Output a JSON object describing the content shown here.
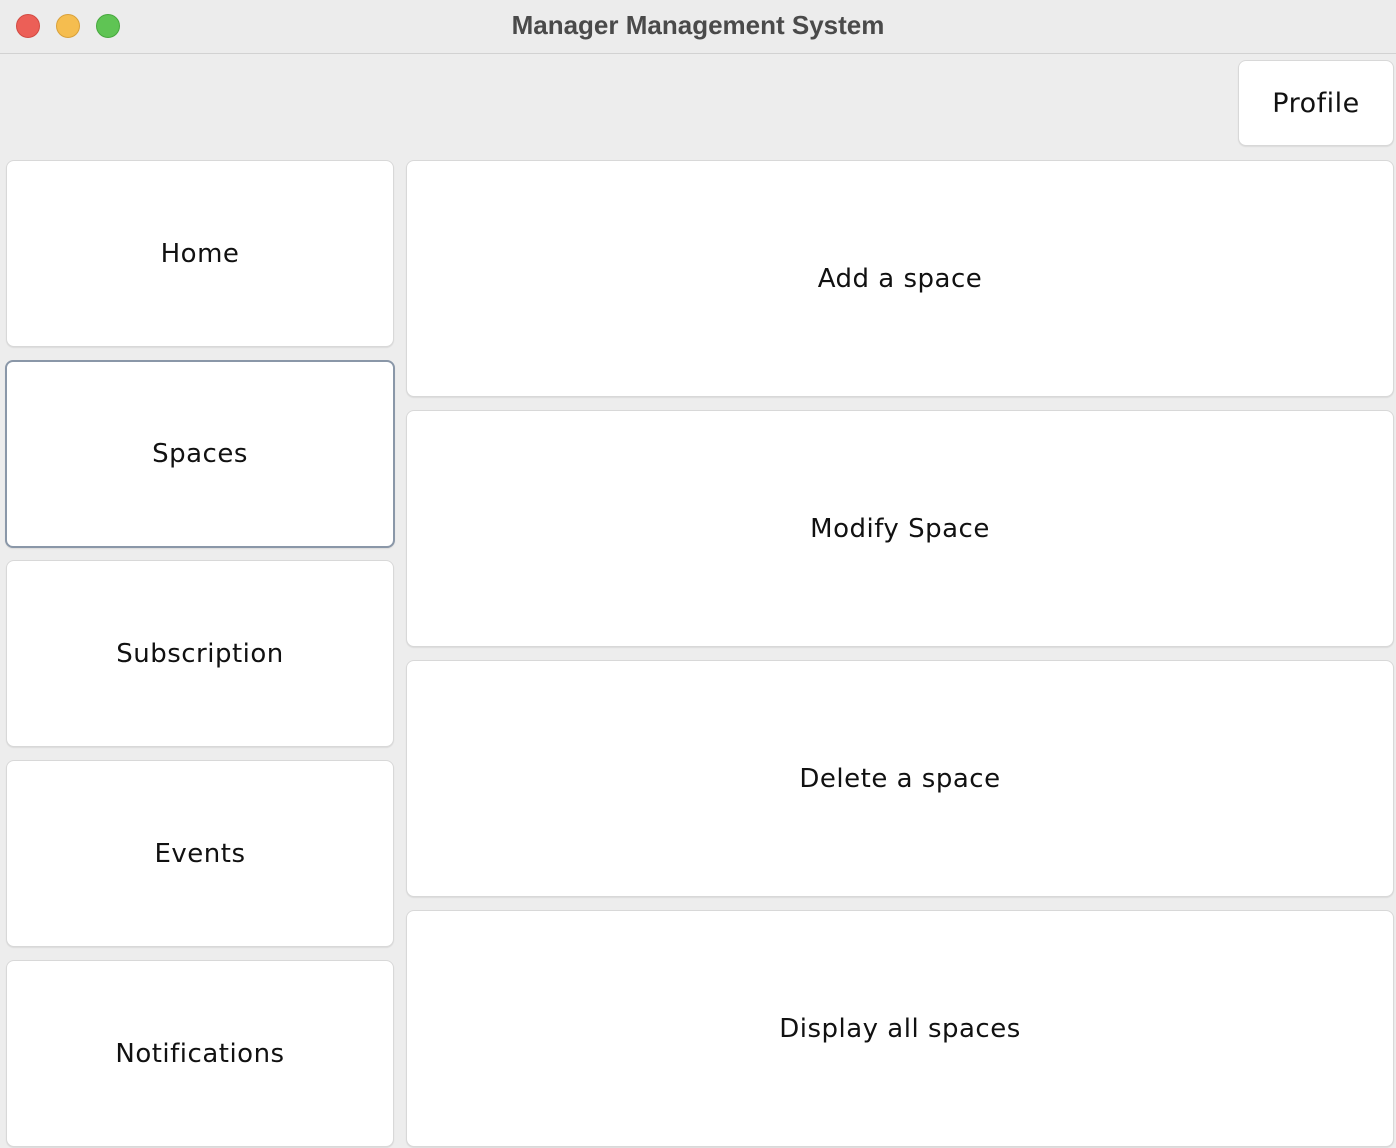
{
  "window": {
    "title": "Manager Management System",
    "controls": {
      "close": "close",
      "minimize": "minimize",
      "zoom": "zoom"
    }
  },
  "header": {
    "profile_label": "Profile"
  },
  "sidebar": {
    "selected": "Spaces",
    "items": [
      {
        "label": "Home"
      },
      {
        "label": "Spaces"
      },
      {
        "label": "Subscription"
      },
      {
        "label": "Events"
      },
      {
        "label": "Notifications"
      }
    ]
  },
  "main": {
    "actions": [
      {
        "label": "Add a space"
      },
      {
        "label": "Modify Space"
      },
      {
        "label": "Delete a space"
      },
      {
        "label": "Display all spaces"
      }
    ]
  },
  "colors": {
    "close": "#ec5f57",
    "minimize": "#f5bd4f",
    "zoom": "#5fc454",
    "selected_border": "#8a97a8"
  }
}
